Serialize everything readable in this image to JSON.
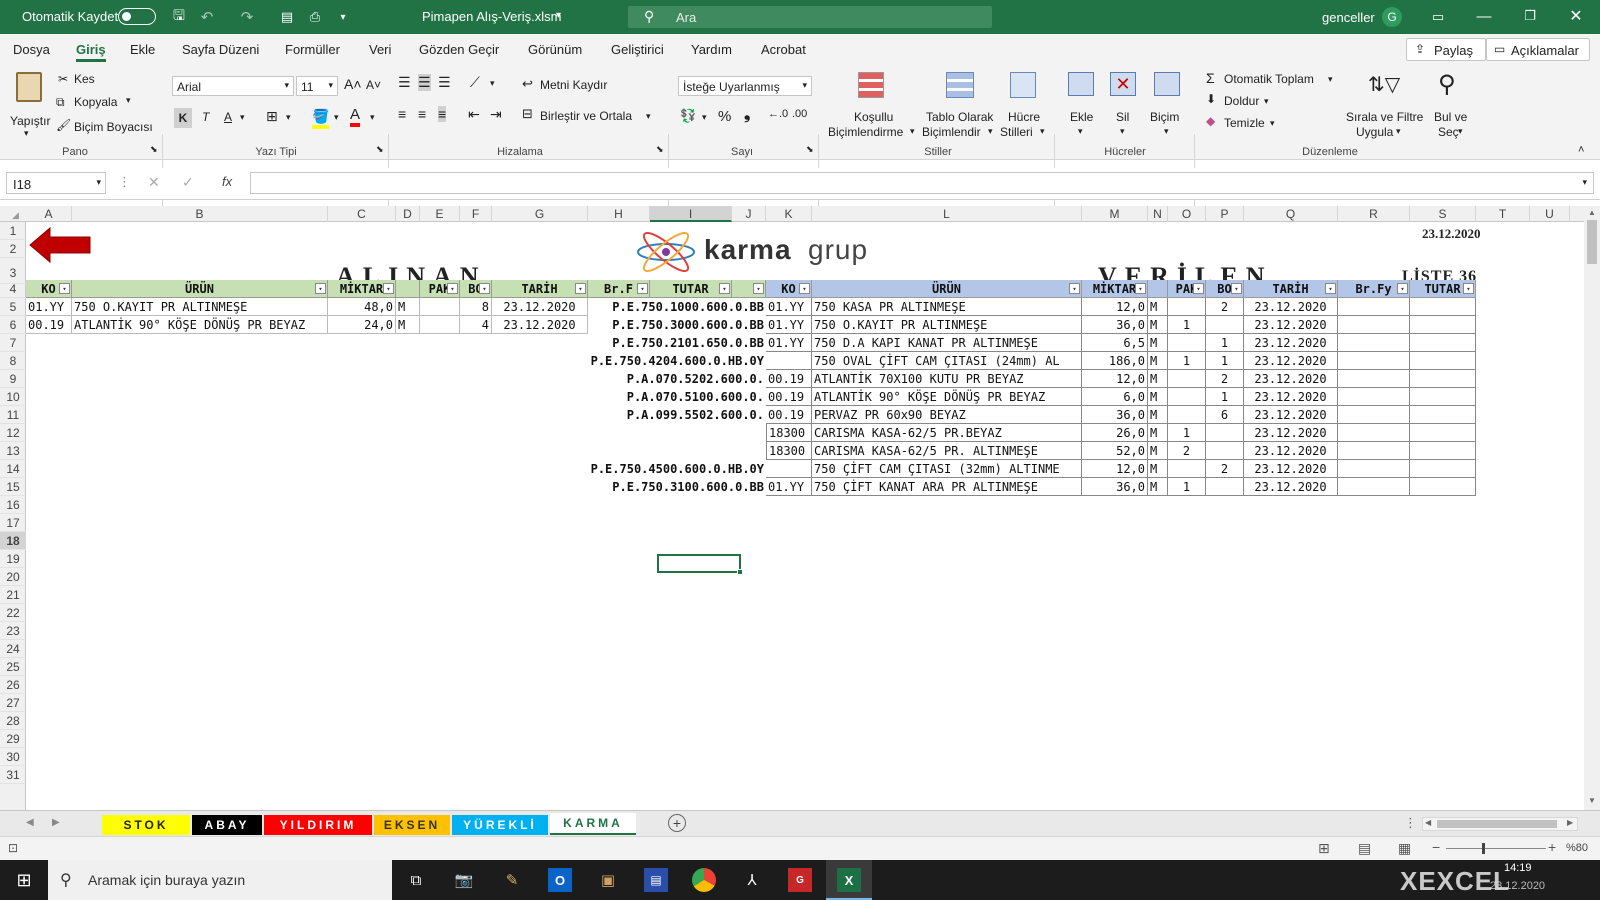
{
  "titlebar": {
    "autosave_label": "Otomatik Kaydet",
    "file_name": "Pimapen Alış-Veriş.xlsm",
    "search_placeholder": "Ara",
    "user_name": "genceller",
    "user_initial": "G"
  },
  "menu_tabs": [
    "Dosya",
    "Giriş",
    "Ekle",
    "Sayfa Düzeni",
    "Formüller",
    "Veri",
    "Gözden Geçir",
    "Görünüm",
    "Geliştirici",
    "Yardım",
    "Acrobat"
  ],
  "share_label": "Paylaş",
  "comments_label": "Açıklamalar",
  "ribbon": {
    "paste": "Yapıştır",
    "cut": "Kes",
    "copy": "Kopyala",
    "format_painter": "Biçim Boyacısı",
    "group_clipboard": "Pano",
    "font_name": "Arial",
    "font_size": "11",
    "bold": "K",
    "italic": "T",
    "underline": "A",
    "group_font": "Yazı Tipi",
    "wrap_text": "Metni Kaydır",
    "merge_center": "Birleştir ve Ortala",
    "group_alignment": "Hizalama",
    "number_format": "İsteğe Uyarlanmış",
    "percent": "%",
    "comma": "❟",
    "group_number": "Sayı",
    "cond_format_1": "Koşullu",
    "cond_format_2": "Biçimlendirme",
    "table_format_1": "Tablo Olarak",
    "table_format_2": "Biçimlendir",
    "cell_styles_1": "Hücre",
    "cell_styles_2": "Stilleri",
    "group_styles": "Stiller",
    "insert": "Ekle",
    "delete": "Sil",
    "format": "Biçim",
    "group_cells": "Hücreler",
    "autosum": "Otomatik Toplam",
    "fill": "Doldur",
    "clear": "Temizle",
    "sort_filter_1": "Sırala ve Filtre",
    "sort_filter_2": "Uygula",
    "find_select_1": "Bul ve",
    "find_select_2": "Seç",
    "group_editing": "Düzenleme"
  },
  "formula_bar": {
    "name_box": "I18",
    "fx": "fx",
    "formula": ""
  },
  "columns": [
    "A",
    "B",
    "C",
    "D",
    "E",
    "F",
    "G",
    "H",
    "I",
    "J",
    "K",
    "L",
    "M",
    "N",
    "O",
    "P",
    "Q",
    "R",
    "S",
    "T",
    "U"
  ],
  "rows": [
    "1",
    "2",
    "3",
    "4",
    "5",
    "6",
    "7",
    "8",
    "9",
    "10",
    "11",
    "12",
    "13",
    "14",
    "15",
    "16",
    "17",
    "18",
    "19",
    "20",
    "21",
    "22",
    "23",
    "24",
    "25",
    "26",
    "27",
    "28",
    "29",
    "30",
    "31"
  ],
  "sheet": {
    "date_top": "23.12.2020",
    "logo_text_bold": "karma",
    "logo_text_light": "grup",
    "title_left": "ALINAN",
    "title_right": "VERİLEN",
    "list_label": "LİSTE 36",
    "left_headers": [
      "KO",
      "ÜRÜN",
      "MİKTAR",
      "",
      "PAK",
      "BO",
      "TARİH",
      "Br.F",
      "TUTAR",
      ""
    ],
    "right_headers": [
      "KO",
      "ÜRÜN",
      "MİKTAR",
      "",
      "PAK",
      "BO",
      "TARİH",
      "Br.Fy",
      "TUTAR"
    ],
    "left_rows": [
      [
        "01.YY",
        "750 O.KAYIT PR ALTINMEŞE",
        "48,0",
        "M",
        "",
        "8",
        "23.12.2020",
        "P.E.750.1000.600.0.BB"
      ],
      [
        "00.19",
        "ATLANTİK 90° KÖŞE DÖNÜŞ PR BEYAZ",
        "24,0",
        "M",
        "",
        "4",
        "23.12.2020",
        "P.E.750.3000.600.0.BB"
      ]
    ],
    "mid_codes": [
      "P.E.750.1000.600.0.BB",
      "P.E.750.3000.600.0.BB",
      "P.E.750.2101.650.0.BB",
      "P.E.750.4204.600.0.HB.0Y",
      "P.A.070.5202.600.0.",
      "P.A.070.5100.600.0.",
      "P.A.099.5502.600.0.",
      "",
      "",
      "P.E.750.4500.600.0.HB.0Y",
      "P.E.750.3100.600.0.BB"
    ],
    "right_rows": [
      [
        "01.YY",
        "750 KASA PR ALTINMEŞE",
        "12,0",
        "M",
        "",
        "2",
        "23.12.2020"
      ],
      [
        "01.YY",
        "750 O.KAYIT PR ALTINMEŞE",
        "36,0",
        "M",
        "1",
        "",
        "23.12.2020"
      ],
      [
        "01.YY",
        "750 D.A KAPI KANAT PR ALTINMEŞE",
        "6,5",
        "M",
        "",
        "1",
        "23.12.2020"
      ],
      [
        "",
        "750 OVAL ÇİFT CAM ÇITASI (24mm) AL",
        "186,0",
        "M",
        "1",
        "1",
        "23.12.2020"
      ],
      [
        "00.19",
        "ATLANTİK 70X100 KUTU PR BEYAZ",
        "12,0",
        "M",
        "",
        "2",
        "23.12.2020"
      ],
      [
        "00.19",
        "ATLANTİK 90° KÖŞE DÖNÜŞ PR BEYAZ",
        "6,0",
        "M",
        "",
        "1",
        "23.12.2020"
      ],
      [
        "00.19",
        "PERVAZ PR 60x90 BEYAZ",
        "36,0",
        "M",
        "",
        "6",
        "23.12.2020"
      ],
      [
        "18300",
        "CARISMA KASA-62/5 PR.BEYAZ",
        "26,0",
        "M",
        "1",
        "",
        "23.12.2020"
      ],
      [
        "18300",
        "CARISMA KASA-62/5 PR. ALTINMEŞE",
        "52,0",
        "M",
        "2",
        "",
        "23.12.2020"
      ],
      [
        "",
        "750 ÇİFT CAM ÇITASI (32mm) ALTINME",
        "12,0",
        "M",
        "",
        "2",
        "23.12.2020"
      ],
      [
        "01.YY",
        "750 ÇİFT KANAT ARA PR ALTINMEŞE",
        "36,0",
        "M",
        "1",
        "",
        "23.12.2020"
      ]
    ]
  },
  "sheet_tabs": [
    {
      "label": "STOK",
      "bg": "#ffff00",
      "fg": "#222222"
    },
    {
      "label": "ABAY",
      "bg": "#000000",
      "fg": "#ffffff"
    },
    {
      "label": "YILDIRIM",
      "bg": "#ff0000",
      "fg": "#ffffff"
    },
    {
      "label": "EKSEN",
      "bg": "#ffc000",
      "fg": "#333333"
    },
    {
      "label": "YÜREKLİ",
      "bg": "#00b0f0",
      "fg": "#ffffff"
    },
    {
      "label": "KARMA",
      "bg": "#ffffff",
      "fg": "#217346"
    }
  ],
  "status": {
    "zoom": "%80"
  },
  "taskbar": {
    "search_placeholder": "Aramak için buraya yazın",
    "time": "14:19",
    "date": "23.12.2020",
    "watermark": "XEXCEL"
  },
  "colors": {
    "excel_green": "#217346",
    "alinan_header": "#c6e0b4",
    "verilen_header": "#b4c6e7",
    "arrow_red": "#c00000"
  }
}
